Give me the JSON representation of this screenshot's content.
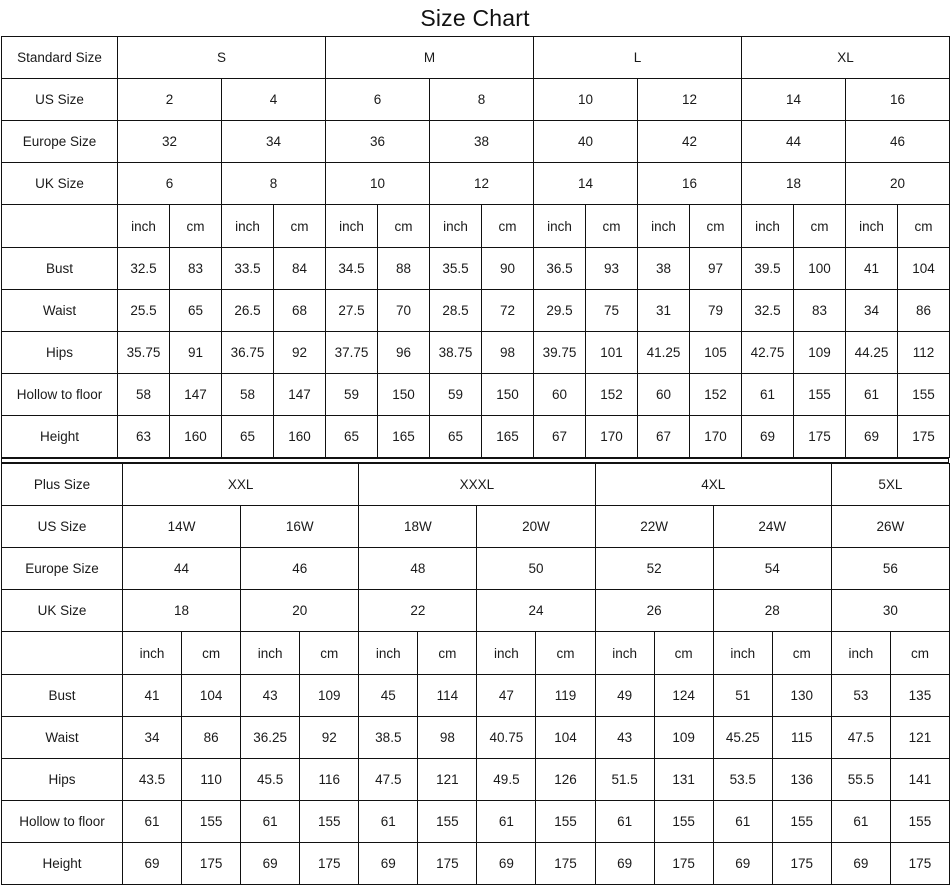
{
  "title": "Size Chart",
  "units": {
    "inch": "inch",
    "cm": "cm"
  },
  "standard": {
    "label_header": "Standard Size",
    "groups": [
      {
        "name": "S",
        "span": 2
      },
      {
        "name": "M",
        "span": 2
      },
      {
        "name": "L",
        "span": 2
      },
      {
        "name": "XL",
        "span": 2
      }
    ],
    "rows": [
      {
        "label": "US Size",
        "shaded": true,
        "values": [
          "2",
          "4",
          "6",
          "8",
          "10",
          "12",
          "14",
          "16"
        ]
      },
      {
        "label": "Europe Size",
        "shaded": false,
        "values": [
          "32",
          "34",
          "36",
          "38",
          "40",
          "42",
          "44",
          "46"
        ]
      },
      {
        "label": "UK Size",
        "shaded": false,
        "values": [
          "6",
          "8",
          "10",
          "12",
          "14",
          "16",
          "18",
          "20"
        ]
      }
    ],
    "measurements": [
      {
        "label": "Bust",
        "inch": [
          "32.5",
          "33.5",
          "34.5",
          "35.5",
          "36.5",
          "38",
          "39.5",
          "41"
        ],
        "cm": [
          "83",
          "84",
          "88",
          "90",
          "93",
          "97",
          "100",
          "104"
        ]
      },
      {
        "label": "Waist",
        "inch": [
          "25.5",
          "26.5",
          "27.5",
          "28.5",
          "29.5",
          "31",
          "32.5",
          "34"
        ],
        "cm": [
          "65",
          "68",
          "70",
          "72",
          "75",
          "79",
          "83",
          "86"
        ]
      },
      {
        "label": "Hips",
        "inch": [
          "35.75",
          "36.75",
          "37.75",
          "38.75",
          "39.75",
          "41.25",
          "42.75",
          "44.25"
        ],
        "cm": [
          "91",
          "92",
          "96",
          "98",
          "101",
          "105",
          "109",
          "112"
        ]
      },
      {
        "label": "Hollow to floor",
        "inch": [
          "58",
          "58",
          "59",
          "59",
          "60",
          "60",
          "61",
          "61"
        ],
        "cm": [
          "147",
          "147",
          "150",
          "150",
          "152",
          "152",
          "155",
          "155"
        ]
      },
      {
        "label": "Height",
        "inch": [
          "63",
          "65",
          "65",
          "65",
          "67",
          "67",
          "69",
          "69"
        ],
        "cm": [
          "160",
          "160",
          "165",
          "165",
          "170",
          "170",
          "175",
          "175"
        ]
      }
    ]
  },
  "plus": {
    "label_header": "Plus Size",
    "groups": [
      {
        "name": "XXL",
        "span": 2
      },
      {
        "name": "XXXL",
        "span": 2
      },
      {
        "name": "4XL",
        "span": 2
      },
      {
        "name": "5XL",
        "span": 1
      }
    ],
    "rows": [
      {
        "label": "US Size",
        "shaded": true,
        "values": [
          "14W",
          "16W",
          "18W",
          "20W",
          "22W",
          "24W",
          "26W"
        ]
      },
      {
        "label": "Europe Size",
        "shaded": false,
        "values": [
          "44",
          "46",
          "48",
          "50",
          "52",
          "54",
          "56"
        ]
      },
      {
        "label": "UK Size",
        "shaded": false,
        "values": [
          "18",
          "20",
          "22",
          "24",
          "26",
          "28",
          "30"
        ]
      }
    ],
    "measurements": [
      {
        "label": "Bust",
        "inch": [
          "41",
          "43",
          "45",
          "47",
          "49",
          "51",
          "53"
        ],
        "cm": [
          "104",
          "109",
          "114",
          "119",
          "124",
          "130",
          "135"
        ]
      },
      {
        "label": "Waist",
        "inch": [
          "34",
          "36.25",
          "38.5",
          "40.75",
          "43",
          "45.25",
          "47.5"
        ],
        "cm": [
          "86",
          "92",
          "98",
          "104",
          "109",
          "115",
          "121"
        ]
      },
      {
        "label": "Hips",
        "inch": [
          "43.5",
          "45.5",
          "47.5",
          "49.5",
          "51.5",
          "53.5",
          "55.5"
        ],
        "cm": [
          "110",
          "116",
          "121",
          "126",
          "131",
          "136",
          "141"
        ]
      },
      {
        "label": "Hollow to floor",
        "inch": [
          "61",
          "61",
          "61",
          "61",
          "61",
          "61",
          "61"
        ],
        "cm": [
          "155",
          "155",
          "155",
          "155",
          "155",
          "155",
          "155"
        ]
      },
      {
        "label": "Height",
        "inch": [
          "69",
          "69",
          "69",
          "69",
          "69",
          "69",
          "69"
        ],
        "cm": [
          "175",
          "175",
          "175",
          "175",
          "175",
          "175",
          "175"
        ]
      }
    ]
  },
  "colors": {
    "shaded_cell": "#c9c9c9",
    "border": "#111111",
    "background": "#ffffff",
    "text": "#1a1a1a"
  }
}
